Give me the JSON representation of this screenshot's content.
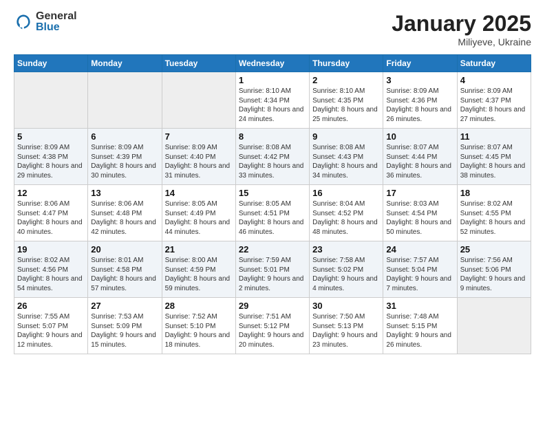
{
  "header": {
    "logo_general": "General",
    "logo_blue": "Blue",
    "month_title": "January 2025",
    "location": "Miliyeve, Ukraine"
  },
  "weekdays": [
    "Sunday",
    "Monday",
    "Tuesday",
    "Wednesday",
    "Thursday",
    "Friday",
    "Saturday"
  ],
  "weeks": [
    [
      {
        "day": "",
        "empty": true
      },
      {
        "day": "",
        "empty": true
      },
      {
        "day": "",
        "empty": true
      },
      {
        "day": "1",
        "sunrise": "8:10 AM",
        "sunset": "4:34 PM",
        "daylight": "8 hours and 24 minutes."
      },
      {
        "day": "2",
        "sunrise": "8:10 AM",
        "sunset": "4:35 PM",
        "daylight": "8 hours and 25 minutes."
      },
      {
        "day": "3",
        "sunrise": "8:09 AM",
        "sunset": "4:36 PM",
        "daylight": "8 hours and 26 minutes."
      },
      {
        "day": "4",
        "sunrise": "8:09 AM",
        "sunset": "4:37 PM",
        "daylight": "8 hours and 27 minutes."
      }
    ],
    [
      {
        "day": "5",
        "sunrise": "8:09 AM",
        "sunset": "4:38 PM",
        "daylight": "8 hours and 29 minutes."
      },
      {
        "day": "6",
        "sunrise": "8:09 AM",
        "sunset": "4:39 PM",
        "daylight": "8 hours and 30 minutes."
      },
      {
        "day": "7",
        "sunrise": "8:09 AM",
        "sunset": "4:40 PM",
        "daylight": "8 hours and 31 minutes."
      },
      {
        "day": "8",
        "sunrise": "8:08 AM",
        "sunset": "4:42 PM",
        "daylight": "8 hours and 33 minutes."
      },
      {
        "day": "9",
        "sunrise": "8:08 AM",
        "sunset": "4:43 PM",
        "daylight": "8 hours and 34 minutes."
      },
      {
        "day": "10",
        "sunrise": "8:07 AM",
        "sunset": "4:44 PM",
        "daylight": "8 hours and 36 minutes."
      },
      {
        "day": "11",
        "sunrise": "8:07 AM",
        "sunset": "4:45 PM",
        "daylight": "8 hours and 38 minutes."
      }
    ],
    [
      {
        "day": "12",
        "sunrise": "8:06 AM",
        "sunset": "4:47 PM",
        "daylight": "8 hours and 40 minutes."
      },
      {
        "day": "13",
        "sunrise": "8:06 AM",
        "sunset": "4:48 PM",
        "daylight": "8 hours and 42 minutes."
      },
      {
        "day": "14",
        "sunrise": "8:05 AM",
        "sunset": "4:49 PM",
        "daylight": "8 hours and 44 minutes."
      },
      {
        "day": "15",
        "sunrise": "8:05 AM",
        "sunset": "4:51 PM",
        "daylight": "8 hours and 46 minutes."
      },
      {
        "day": "16",
        "sunrise": "8:04 AM",
        "sunset": "4:52 PM",
        "daylight": "8 hours and 48 minutes."
      },
      {
        "day": "17",
        "sunrise": "8:03 AM",
        "sunset": "4:54 PM",
        "daylight": "8 hours and 50 minutes."
      },
      {
        "day": "18",
        "sunrise": "8:02 AM",
        "sunset": "4:55 PM",
        "daylight": "8 hours and 52 minutes."
      }
    ],
    [
      {
        "day": "19",
        "sunrise": "8:02 AM",
        "sunset": "4:56 PM",
        "daylight": "8 hours and 54 minutes."
      },
      {
        "day": "20",
        "sunrise": "8:01 AM",
        "sunset": "4:58 PM",
        "daylight": "8 hours and 57 minutes."
      },
      {
        "day": "21",
        "sunrise": "8:00 AM",
        "sunset": "4:59 PM",
        "daylight": "8 hours and 59 minutes."
      },
      {
        "day": "22",
        "sunrise": "7:59 AM",
        "sunset": "5:01 PM",
        "daylight": "9 hours and 2 minutes."
      },
      {
        "day": "23",
        "sunrise": "7:58 AM",
        "sunset": "5:02 PM",
        "daylight": "9 hours and 4 minutes."
      },
      {
        "day": "24",
        "sunrise": "7:57 AM",
        "sunset": "5:04 PM",
        "daylight": "9 hours and 7 minutes."
      },
      {
        "day": "25",
        "sunrise": "7:56 AM",
        "sunset": "5:06 PM",
        "daylight": "9 hours and 9 minutes."
      }
    ],
    [
      {
        "day": "26",
        "sunrise": "7:55 AM",
        "sunset": "5:07 PM",
        "daylight": "9 hours and 12 minutes."
      },
      {
        "day": "27",
        "sunrise": "7:53 AM",
        "sunset": "5:09 PM",
        "daylight": "9 hours and 15 minutes."
      },
      {
        "day": "28",
        "sunrise": "7:52 AM",
        "sunset": "5:10 PM",
        "daylight": "9 hours and 18 minutes."
      },
      {
        "day": "29",
        "sunrise": "7:51 AM",
        "sunset": "5:12 PM",
        "daylight": "9 hours and 20 minutes."
      },
      {
        "day": "30",
        "sunrise": "7:50 AM",
        "sunset": "5:13 PM",
        "daylight": "9 hours and 23 minutes."
      },
      {
        "day": "31",
        "sunrise": "7:48 AM",
        "sunset": "5:15 PM",
        "daylight": "9 hours and 26 minutes."
      },
      {
        "day": "",
        "empty": true
      }
    ]
  ]
}
